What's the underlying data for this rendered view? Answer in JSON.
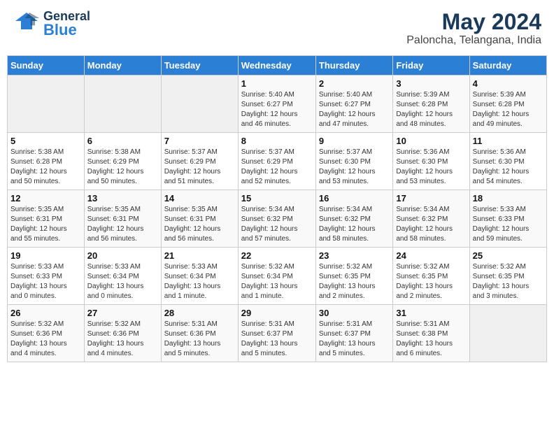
{
  "header": {
    "logo_general": "General",
    "logo_blue": "Blue",
    "title": "May 2024",
    "subtitle": "Paloncha, Telangana, India"
  },
  "days_of_week": [
    "Sunday",
    "Monday",
    "Tuesday",
    "Wednesday",
    "Thursday",
    "Friday",
    "Saturday"
  ],
  "weeks": [
    [
      {
        "day": "",
        "info": ""
      },
      {
        "day": "",
        "info": ""
      },
      {
        "day": "",
        "info": ""
      },
      {
        "day": "1",
        "info": "Sunrise: 5:40 AM\nSunset: 6:27 PM\nDaylight: 12 hours\nand 46 minutes."
      },
      {
        "day": "2",
        "info": "Sunrise: 5:40 AM\nSunset: 6:27 PM\nDaylight: 12 hours\nand 47 minutes."
      },
      {
        "day": "3",
        "info": "Sunrise: 5:39 AM\nSunset: 6:28 PM\nDaylight: 12 hours\nand 48 minutes."
      },
      {
        "day": "4",
        "info": "Sunrise: 5:39 AM\nSunset: 6:28 PM\nDaylight: 12 hours\nand 49 minutes."
      }
    ],
    [
      {
        "day": "5",
        "info": "Sunrise: 5:38 AM\nSunset: 6:28 PM\nDaylight: 12 hours\nand 50 minutes."
      },
      {
        "day": "6",
        "info": "Sunrise: 5:38 AM\nSunset: 6:29 PM\nDaylight: 12 hours\nand 50 minutes."
      },
      {
        "day": "7",
        "info": "Sunrise: 5:37 AM\nSunset: 6:29 PM\nDaylight: 12 hours\nand 51 minutes."
      },
      {
        "day": "8",
        "info": "Sunrise: 5:37 AM\nSunset: 6:29 PM\nDaylight: 12 hours\nand 52 minutes."
      },
      {
        "day": "9",
        "info": "Sunrise: 5:37 AM\nSunset: 6:30 PM\nDaylight: 12 hours\nand 53 minutes."
      },
      {
        "day": "10",
        "info": "Sunrise: 5:36 AM\nSunset: 6:30 PM\nDaylight: 12 hours\nand 53 minutes."
      },
      {
        "day": "11",
        "info": "Sunrise: 5:36 AM\nSunset: 6:30 PM\nDaylight: 12 hours\nand 54 minutes."
      }
    ],
    [
      {
        "day": "12",
        "info": "Sunrise: 5:35 AM\nSunset: 6:31 PM\nDaylight: 12 hours\nand 55 minutes."
      },
      {
        "day": "13",
        "info": "Sunrise: 5:35 AM\nSunset: 6:31 PM\nDaylight: 12 hours\nand 56 minutes."
      },
      {
        "day": "14",
        "info": "Sunrise: 5:35 AM\nSunset: 6:31 PM\nDaylight: 12 hours\nand 56 minutes."
      },
      {
        "day": "15",
        "info": "Sunrise: 5:34 AM\nSunset: 6:32 PM\nDaylight: 12 hours\nand 57 minutes."
      },
      {
        "day": "16",
        "info": "Sunrise: 5:34 AM\nSunset: 6:32 PM\nDaylight: 12 hours\nand 58 minutes."
      },
      {
        "day": "17",
        "info": "Sunrise: 5:34 AM\nSunset: 6:32 PM\nDaylight: 12 hours\nand 58 minutes."
      },
      {
        "day": "18",
        "info": "Sunrise: 5:33 AM\nSunset: 6:33 PM\nDaylight: 12 hours\nand 59 minutes."
      }
    ],
    [
      {
        "day": "19",
        "info": "Sunrise: 5:33 AM\nSunset: 6:33 PM\nDaylight: 13 hours\nand 0 minutes."
      },
      {
        "day": "20",
        "info": "Sunrise: 5:33 AM\nSunset: 6:34 PM\nDaylight: 13 hours\nand 0 minutes."
      },
      {
        "day": "21",
        "info": "Sunrise: 5:33 AM\nSunset: 6:34 PM\nDaylight: 13 hours\nand 1 minute."
      },
      {
        "day": "22",
        "info": "Sunrise: 5:32 AM\nSunset: 6:34 PM\nDaylight: 13 hours\nand 1 minute."
      },
      {
        "day": "23",
        "info": "Sunrise: 5:32 AM\nSunset: 6:35 PM\nDaylight: 13 hours\nand 2 minutes."
      },
      {
        "day": "24",
        "info": "Sunrise: 5:32 AM\nSunset: 6:35 PM\nDaylight: 13 hours\nand 2 minutes."
      },
      {
        "day": "25",
        "info": "Sunrise: 5:32 AM\nSunset: 6:35 PM\nDaylight: 13 hours\nand 3 minutes."
      }
    ],
    [
      {
        "day": "26",
        "info": "Sunrise: 5:32 AM\nSunset: 6:36 PM\nDaylight: 13 hours\nand 4 minutes."
      },
      {
        "day": "27",
        "info": "Sunrise: 5:32 AM\nSunset: 6:36 PM\nDaylight: 13 hours\nand 4 minutes."
      },
      {
        "day": "28",
        "info": "Sunrise: 5:31 AM\nSunset: 6:36 PM\nDaylight: 13 hours\nand 5 minutes."
      },
      {
        "day": "29",
        "info": "Sunrise: 5:31 AM\nSunset: 6:37 PM\nDaylight: 13 hours\nand 5 minutes."
      },
      {
        "day": "30",
        "info": "Sunrise: 5:31 AM\nSunset: 6:37 PM\nDaylight: 13 hours\nand 5 minutes."
      },
      {
        "day": "31",
        "info": "Sunrise: 5:31 AM\nSunset: 6:38 PM\nDaylight: 13 hours\nand 6 minutes."
      },
      {
        "day": "",
        "info": ""
      }
    ]
  ]
}
